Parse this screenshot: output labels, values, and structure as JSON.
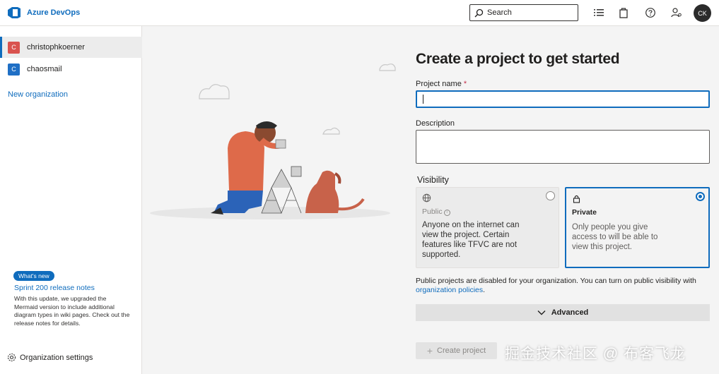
{
  "header": {
    "brand": "Azure DevOps",
    "search_label": "Search",
    "avatar_initials": "CK"
  },
  "sidebar": {
    "organizations": [
      {
        "name": "christophkoerner",
        "initial": "C",
        "color": "#d9534f",
        "selected": true
      },
      {
        "name": "chaosmail",
        "initial": "C",
        "color": "#1f6fc5",
        "selected": false
      }
    ],
    "new_org_label": "New organization",
    "whats_new_badge": "What's new",
    "release_link": "Sprint 200 release notes",
    "release_body": "With this update, we upgraded the Mermaid version to include additional diagram types in wiki pages. Check out the release notes for details.",
    "settings_label": "Organization settings"
  },
  "form": {
    "title": "Create a project to get started",
    "project_name_label": "Project name",
    "required_mark": "*",
    "project_name_value": "",
    "description_label": "Description",
    "description_value": "",
    "visibility_label": "Visibility",
    "public": {
      "name": "Public",
      "description": "Anyone on the internet can view the project. Certain features like TFVC are not supported."
    },
    "private": {
      "name": "Private",
      "description": "Only people you give access to will be able to view this project."
    },
    "policy_note_prefix": "Public projects are disabled for your organization. You can turn on public visibility with ",
    "policy_link": "organization policies",
    "policy_note_suffix": ".",
    "advanced_label": "Advanced",
    "create_label": "Create project"
  },
  "watermark": "掘金技术社区 @ 布客飞龙",
  "colors": {
    "accent": "#0f6cbd",
    "required": "#c4314b"
  }
}
